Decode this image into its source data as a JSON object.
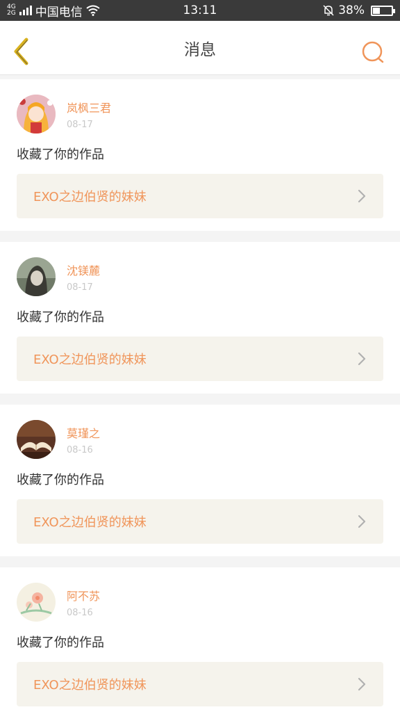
{
  "status_bar": {
    "network": "4G\n2G",
    "carrier": "中国电信",
    "time": "13:11",
    "battery": "38%",
    "battery_level": 0.38
  },
  "header": {
    "title": "消息",
    "back_icon": "chevron-left-icon",
    "search_icon": "search-icon"
  },
  "colors": {
    "accent": "#f0955a",
    "back_icon": "#d9b21f",
    "link_bg": "#f5f3ec"
  },
  "messages": [
    {
      "user": "岚枫三君",
      "date": "08-17",
      "action": "收藏了你的作品",
      "work": "EXO之边伯贤的妹妹",
      "avatar": "anime-girl-avatar"
    },
    {
      "user": "沈镁麓",
      "date": "08-17",
      "action": "收藏了你的作品",
      "work": "EXO之边伯贤的妹妹",
      "avatar": "portrait-avatar"
    },
    {
      "user": "莫瑾之",
      "date": "08-16",
      "action": "收藏了你的作品",
      "work": "EXO之边伯贤的妹妹",
      "avatar": "book-avatar"
    },
    {
      "user": "阿不苏",
      "date": "08-16",
      "action": "收藏了你的作品",
      "work": "EXO之边伯贤的妹妹",
      "avatar": "flower-avatar"
    }
  ]
}
